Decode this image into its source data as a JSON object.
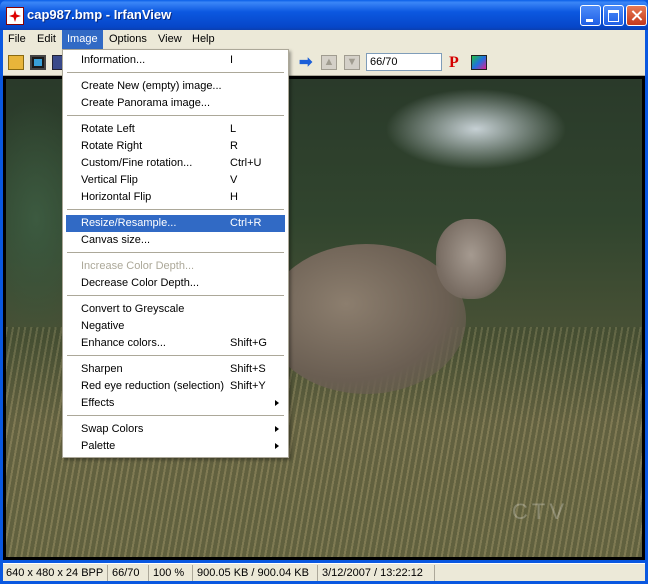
{
  "window": {
    "title": "cap987.bmp - IrfanView"
  },
  "menubar": {
    "items": [
      "File",
      "Edit",
      "Image",
      "Options",
      "View",
      "Help"
    ]
  },
  "toolbar": {
    "page_value": "66/70"
  },
  "image_menu": {
    "items": [
      {
        "label": "Information...",
        "shortcut": "I"
      },
      {
        "label": "Create New (empty) image...",
        "shortcut": ""
      },
      {
        "label": "Create Panorama image...",
        "shortcut": ""
      },
      {
        "label": "Rotate Left",
        "shortcut": "L"
      },
      {
        "label": "Rotate Right",
        "shortcut": "R"
      },
      {
        "label": "Custom/Fine rotation...",
        "shortcut": "Ctrl+U"
      },
      {
        "label": "Vertical Flip",
        "shortcut": "V"
      },
      {
        "label": "Horizontal Flip",
        "shortcut": "H"
      },
      {
        "label": "Resize/Resample...",
        "shortcut": "Ctrl+R"
      },
      {
        "label": "Canvas size...",
        "shortcut": ""
      },
      {
        "label": "Increase Color Depth...",
        "shortcut": ""
      },
      {
        "label": "Decrease Color Depth...",
        "shortcut": ""
      },
      {
        "label": "Convert to Greyscale",
        "shortcut": ""
      },
      {
        "label": "Negative",
        "shortcut": ""
      },
      {
        "label": "Enhance colors...",
        "shortcut": "Shift+G"
      },
      {
        "label": "Sharpen",
        "shortcut": "Shift+S"
      },
      {
        "label": "Red eye reduction (selection)",
        "shortcut": "Shift+Y"
      },
      {
        "label": "Effects",
        "shortcut": ""
      },
      {
        "label": "Swap Colors",
        "shortcut": ""
      },
      {
        "label": "Palette",
        "shortcut": ""
      }
    ]
  },
  "image": {
    "watermark": "CTV"
  },
  "statusbar": {
    "dimensions": "640 x 480 x 24 BPP",
    "page": "66/70",
    "zoom": "100 %",
    "size": "900.05 KB / 900.04 KB",
    "datetime": "3/12/2007 / 13:22:12"
  },
  "colors": {
    "titlebar": "#0a58e0",
    "highlight": "#316ac5",
    "chrome": "#ece9d8"
  }
}
